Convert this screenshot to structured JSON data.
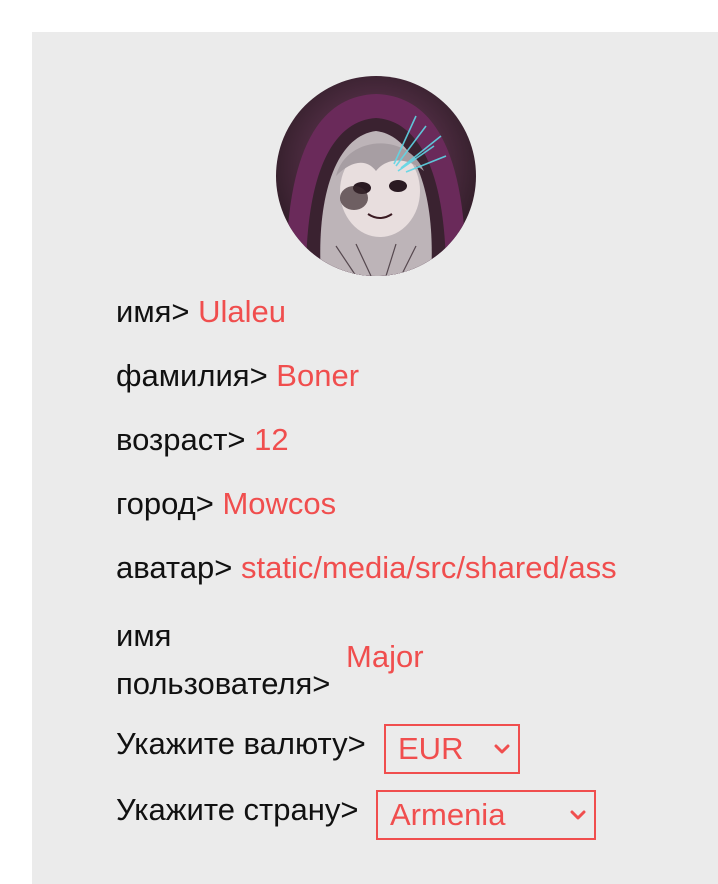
{
  "profile": {
    "fields": [
      {
        "label": "имя>",
        "value": "Ulaleu"
      },
      {
        "label": "фамилия>",
        "value": "Boner"
      },
      {
        "label": "возраст>",
        "value": "12"
      },
      {
        "label": "город>",
        "value": "Mowcos"
      },
      {
        "label": "аватар>",
        "value": "static/media/src/shared/ass"
      }
    ],
    "username": {
      "label_line1": "имя",
      "label_line2": "пользователя>",
      "value": "Major"
    },
    "currency": {
      "label": "Укажите валюту>",
      "selected": "EUR"
    },
    "country": {
      "label": "Укажите страну>",
      "selected": "Armenia"
    }
  },
  "colors": {
    "value": "#f04e4e",
    "label": "#111111",
    "card_background": "#ebebeb"
  },
  "icons": {
    "avatar": "avatar-image",
    "select_chevron": "chevron-down-icon"
  }
}
